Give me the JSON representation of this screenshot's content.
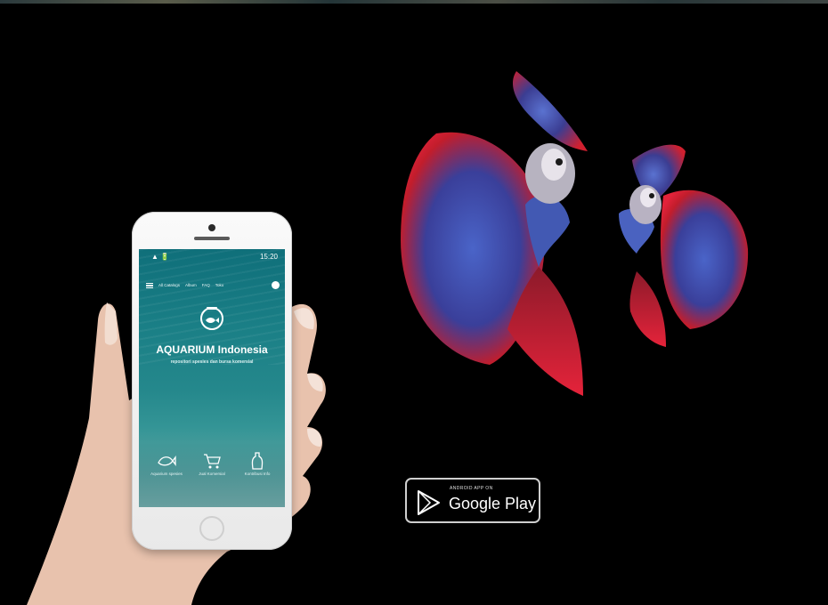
{
  "app": {
    "title": "AQUARIUM Indonesia",
    "tagline": "repositori spesies dan bursa komersial",
    "status_left": "▲ 🔋",
    "status_time": "15:20",
    "nav_links": [
      "All Catalogs",
      "Album",
      "FAQ",
      "Toko"
    ],
    "features": [
      "Aquarium spesies",
      "Jual Komersial",
      "Kontribusi Info"
    ]
  },
  "store_badge": {
    "small_label": "ANDROID APP ON",
    "store_name": "Google Play"
  },
  "colors": {
    "background": "#000000",
    "app_teal": "#1a7f86",
    "fish_red": "#c8202c",
    "fish_blue": "#2f4fa8"
  },
  "icons": [
    "fishbowl-icon",
    "fish-icon",
    "cart-icon",
    "bottle-icon",
    "play-triangle-icon"
  ]
}
